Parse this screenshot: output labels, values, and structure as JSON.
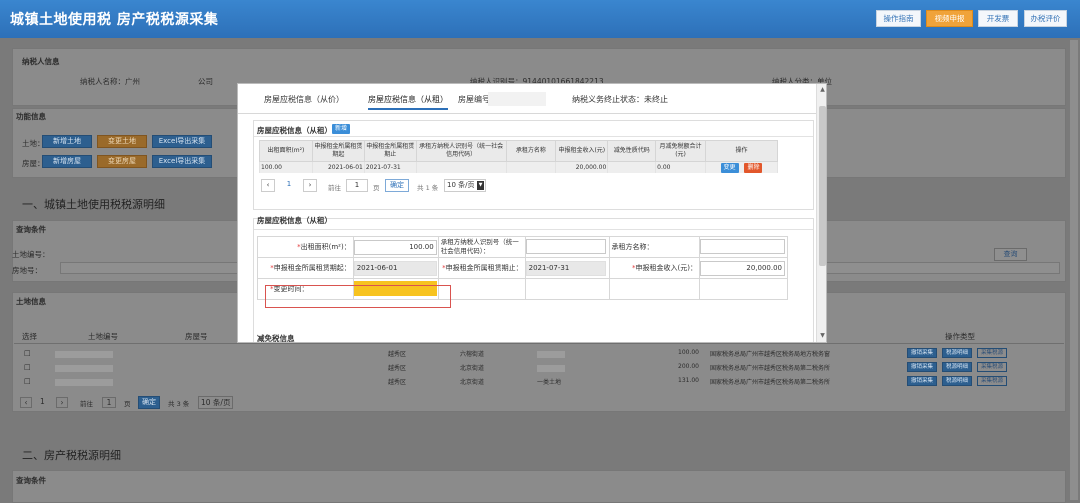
{
  "header": {
    "title": "城镇土地使用税 房产税税源采集",
    "buttons": [
      "操作指南",
      "视频申报",
      "开发票",
      "办税评价"
    ]
  },
  "background": {
    "section_taxpayer": "纳税人信息",
    "taxpayer_name_label": "纳税人名称：广州",
    "taxpayer_name_suffix": "公司",
    "taxpayer_id_label": "纳税人识别号：91440101661842213",
    "taxpayer_extra": "纳税人分类：单位",
    "section_func": "功能信息",
    "land_label": "土地：",
    "house_label": "房屋：",
    "land_buttons": [
      "新增土地",
      "变更土地",
      "Excel导出采集"
    ],
    "house_buttons": [
      "新增房屋",
      "变更房屋",
      "Excel导出采集"
    ],
    "land_tax_title": "一、城镇土地使用税税源明细",
    "query_conditions": "查询条件",
    "land_no_label": "土地编号：",
    "house_no_label": "房地号：",
    "query_button": "查询",
    "land_info": "土地信息",
    "col_select": "选择",
    "col_land_no": "土地编号",
    "col_house_no": "房屋号",
    "col_ops": "操作类型",
    "rows": [
      {
        "district": "越秀区",
        "street": "六榕街道",
        "area": "100.00",
        "auth": "国家税务总局广州市越秀区税务局地方税务窗",
        "b1": "撤销采集",
        "b2": "税源明细",
        "b3": "采集税源"
      },
      {
        "district": "越秀区",
        "street": "北京街道",
        "area": "200.00",
        "auth": "国家税务总局广州市越秀区税务局第二税务所",
        "b1": "撤销采集",
        "b2": "税源明细",
        "b3": "采集税源"
      },
      {
        "district": "越秀区",
        "street": "北京街道",
        "extra": "一类土地",
        "area": "131.00",
        "auth": "国家税务总局广州市越秀区税务局第二税务所",
        "b1": "撤销采集",
        "b2": "税源明细",
        "b3": "采集税源"
      }
    ],
    "pager": {
      "page": "1",
      "goto_prefix": "前往",
      "goto_value": "1",
      "goto_suffix": "页",
      "confirm": "确定",
      "total": "共 3 条",
      "size": "10 条/页"
    },
    "house_tax_title": "二、房产税税源明细",
    "query_conditions2": "查询条件"
  },
  "modal": {
    "tabs": [
      "房屋应税信息（从价）",
      "房屋应税信息（从租）"
    ],
    "tab_extra_label": "房屋编号",
    "tab_status": "纳税义务终止状态：未终止",
    "section1": {
      "title": "房屋应税信息（从租）",
      "add_button": "新增",
      "columns": [
        "出租面积(m²)",
        "申报租金所属租赁期起",
        "申报租金所属租赁期止",
        "承租方纳税人识别号（统一社会信用代码）",
        "承租方名称",
        "申报租金收入(元)",
        "减免性质代码",
        "月减免税额合计(元)",
        "操作"
      ],
      "row": {
        "area": "100.00",
        "start": "2021-06-01",
        "end": "2021-07-31",
        "tenant_id": "",
        "tenant_name": "",
        "income": "20,000.00",
        "relief_code": "",
        "relief_total": "0.00",
        "btn_change": "变更",
        "btn_delete": "删除"
      },
      "pager": {
        "prev": "‹",
        "page": "1",
        "next": "›",
        "goto_prefix": "前往",
        "goto_value": "1",
        "goto_suffix": "页",
        "confirm": "确定",
        "total": "共 1 条",
        "size": "10 条/页"
      }
    },
    "section2": {
      "title": "房屋应税信息（从租）",
      "fields": {
        "rent_area_label": "出租面积(m²)：",
        "rent_area_value": "100.00",
        "tenant_id_label": "承租方纳税人识别号（统一社会信用代码）：",
        "tenant_id_value": "",
        "tenant_name_label": "承租方名称：",
        "tenant_name_value": "",
        "start_label": "申报租金所属租赁期起：",
        "start_value": "2021-06-01",
        "end_label": "申报租金所属租赁期止：",
        "end_value": "2021-07-31",
        "income_label": "申报租金收入(元)：",
        "income_value": "20,000.00",
        "change_time_label": "变更时间："
      }
    },
    "section3_title": "减免税信息"
  },
  "colors": {
    "header": "#2d70b8",
    "accent_orange": "#f0a33a",
    "highlight": "#f7c31f",
    "error_outline": "#d9534f"
  }
}
